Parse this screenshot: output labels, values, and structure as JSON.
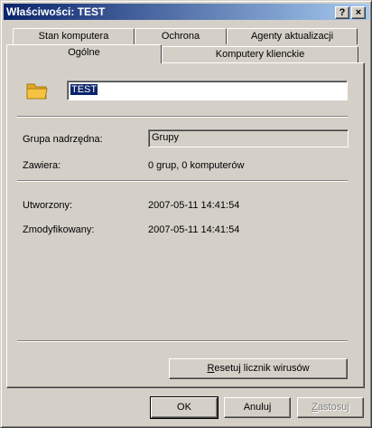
{
  "window": {
    "title": "Właściwości: TEST",
    "help_glyph": "?",
    "close_glyph": "×"
  },
  "tabs": {
    "row_back": [
      "Stan komputera",
      "Ochrona",
      "Agenty aktualizacji"
    ],
    "row_front": [
      "Ogólne",
      "Komputery klienckie"
    ],
    "active": "Ogólne"
  },
  "general": {
    "icon": "folder-icon",
    "name_value": "TEST",
    "parent_group_label": "Grupa nadrzędna:",
    "parent_group_value": "Grupy",
    "contains_label": "Zawiera:",
    "contains_value": "0 grup, 0 komputerów",
    "created_label": "Utworzony:",
    "created_value": "2007-05-11 14:41:54",
    "modified_label": "Zmodyfikowany:",
    "modified_value": "2007-05-11 14:41:54",
    "reset_button_first": "R",
    "reset_button_rest": "esetuj licznik wirusów"
  },
  "footer": {
    "ok": "OK",
    "cancel": "Anuluj",
    "apply_first": "Z",
    "apply_rest": "astosuj"
  },
  "colors": {
    "face": "#d4d0c8",
    "titlebar_start": "#0a246a",
    "titlebar_end": "#a6caf0",
    "folder": "#f5c242"
  }
}
